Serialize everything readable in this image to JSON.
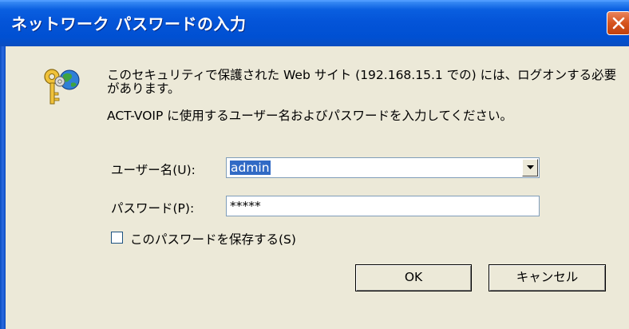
{
  "window": {
    "title": "ネットワーク パスワードの入力"
  },
  "icons": {
    "close": "close-icon",
    "keys": "keys-icon",
    "dropdown": "chevron-down-icon"
  },
  "message": {
    "line1": "このセキュリティで保護された Web サイト (192.168.15.1 での) には、ログオンする必要",
    "line2": "があります。",
    "line3": "ACT-VOIP に使用するユーザー名およびパスワードを入力してください。"
  },
  "form": {
    "username_label": "ユーザー名(U):",
    "username_value": "admin",
    "password_label": "パスワード(P):",
    "password_value": "*****",
    "remember_label": "このパスワードを保存する(S)",
    "remember_checked": false
  },
  "buttons": {
    "ok": "OK",
    "cancel": "キャンセル"
  },
  "colors": {
    "titlebar": "#0454d8",
    "selection": "#316ac5",
    "dialog_bg": "#ece9d8",
    "close_button": "#d6541e"
  }
}
